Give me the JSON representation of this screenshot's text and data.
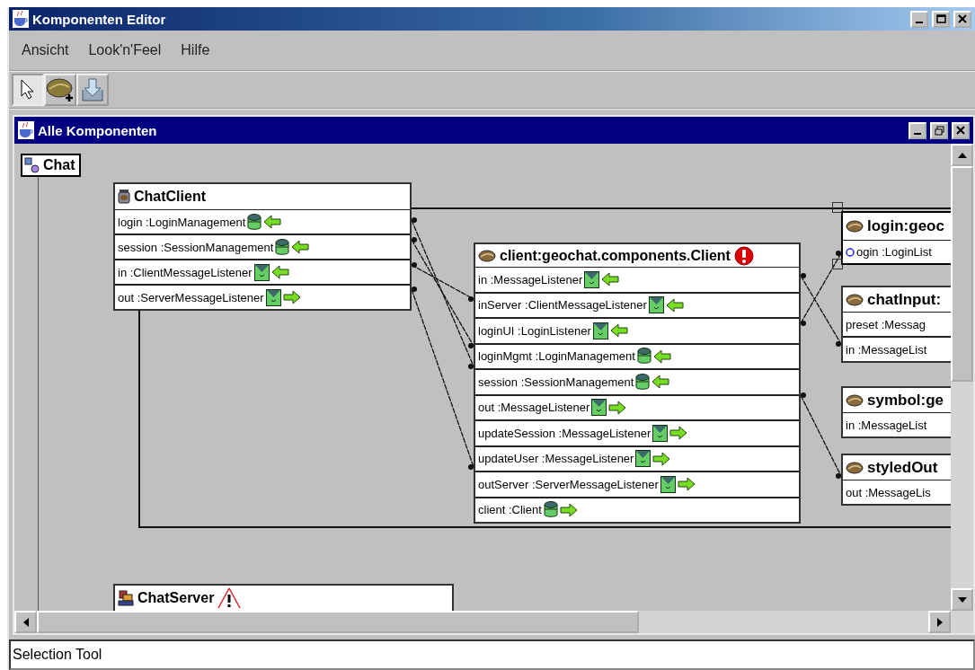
{
  "window": {
    "title": "Komponenten Editor"
  },
  "menu": [
    {
      "label": "Ansicht"
    },
    {
      "label": "Look'n'Feel"
    },
    {
      "label": "Hilfe"
    }
  ],
  "toolbar": [
    {
      "kind": "select",
      "selected": true
    },
    {
      "kind": "bean",
      "selected": false
    },
    {
      "kind": "import",
      "selected": false
    }
  ],
  "internal_frame": {
    "title": "Alle Komponenten",
    "group": "Chat",
    "components": [
      {
        "name": "ChatClient",
        "kind": "container",
        "error": false,
        "warning": false,
        "selected": false,
        "ports": [
          {
            "label": "login :LoginManagement",
            "kind": "service",
            "outgoing": false
          },
          {
            "label": "session :SessionManagement",
            "kind": "service",
            "outgoing": false
          },
          {
            "label": "in :ClientMessageListener",
            "kind": "listener",
            "outgoing": false
          },
          {
            "label": "out :ServerMessageListener",
            "kind": "listener",
            "outgoing": true
          }
        ]
      },
      {
        "name": "client:geochat.components.Client",
        "kind": "bean",
        "error": true,
        "warning": false,
        "selected": false,
        "ports": [
          {
            "label": "in :MessageListener",
            "kind": "listener",
            "outgoing": false
          },
          {
            "label": "inServer :ClientMessageListener",
            "kind": "listener",
            "outgoing": false
          },
          {
            "label": "loginUI :LoginListener",
            "kind": "listener",
            "outgoing": false
          },
          {
            "label": "loginMgmt :LoginManagement",
            "kind": "service",
            "outgoing": false
          },
          {
            "label": "session :SessionManagement",
            "kind": "service",
            "outgoing": false
          },
          {
            "label": "out :MessageListener",
            "kind": "listener",
            "outgoing": true
          },
          {
            "label": "updateSession :MessageListener",
            "kind": "listener",
            "outgoing": true
          },
          {
            "label": "updateUser :MessageListener",
            "kind": "listener",
            "outgoing": true
          },
          {
            "label": "outServer :ServerMessageListener",
            "kind": "listener",
            "outgoing": true
          },
          {
            "label": "client :Client",
            "kind": "service",
            "outgoing": true
          }
        ]
      },
      {
        "name": "login:geoc",
        "kind": "bean",
        "error": false,
        "warning": false,
        "selected": true,
        "ports": [
          {
            "label": "ogin :LoginList"
          }
        ]
      },
      {
        "name": "chatInput:",
        "kind": "bean",
        "error": false,
        "warning": false,
        "selected": false,
        "ports": [
          {
            "label": "preset :Messag"
          },
          {
            "label": "in :MessageList"
          }
        ]
      },
      {
        "name": "symbol:ge",
        "kind": "bean",
        "error": false,
        "warning": false,
        "selected": false,
        "ports": [
          {
            "label": "in :MessageList"
          }
        ]
      },
      {
        "name": "styledOut",
        "kind": "bean",
        "error": false,
        "warning": false,
        "selected": false,
        "ports": [
          {
            "label": "out :MessageLis"
          }
        ]
      },
      {
        "name": "ChatServer",
        "kind": "server",
        "error": false,
        "warning": true,
        "selected": false
      }
    ]
  },
  "status_bar": "Selection Tool"
}
